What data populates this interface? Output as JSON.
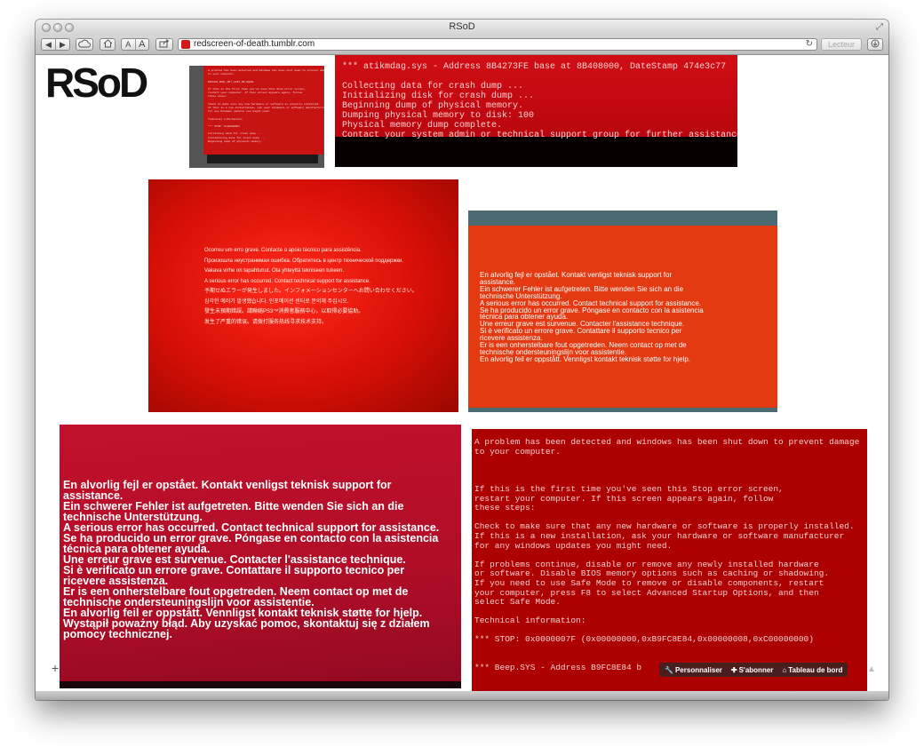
{
  "window": {
    "title": "RSoD"
  },
  "toolbar": {
    "font_small": "A",
    "font_large": "A",
    "url": "redscreen-of-death.tumblr.com",
    "reader_label": "Lecteur"
  },
  "blog": {
    "logo": "RSoD"
  },
  "photos": {
    "p1": {
      "lines": [
        "A problem has been detected and Windows has been shut down to prevent damage",
        "to your computer.",
        "",
        "DRIVER_IRQL_NOT_LESS_OR_EQUAL",
        "",
        "If this is the first time you've seen this Stop error screen,",
        "restart your computer. If this screen appears again, follow",
        "these steps:",
        "",
        "Check to make sure any new hardware or software is properly installed.",
        "If this is a new installation, ask your hardware or software manufacturer",
        "for any Windows updates you might need.",
        "",
        "Technical information:",
        "",
        "*** STOP: 0x000000D1",
        "",
        "Collecting data for crash dump ...",
        "Initializing disk for crash dump ...",
        "Beginning dump of physical memory."
      ]
    },
    "p2": {
      "lines": [
        "***  atikmdag.sys - Address 8B4273FE base at 8B408000, DateStamp 474e3c77",
        "",
        "Collecting data for crash dump ...",
        "Initializing disk for crash dump ...",
        "Beginning dump of physical memory.",
        "Dumping physical memory to disk:  100",
        "Physical memory dump complete.",
        "Contact your system admin or technical support group for further assistance."
      ]
    },
    "p3": {
      "lines": [
        "Ocorreu um erro grave. Contacte o apoio técnico para assistência.",
        "Произошла неустранимая ошибка. Обратитесь в центр технической поддержки.",
        "Vakava virhe on tapahtunut. Ota yhteyttä tekniseen tukeen.",
        "A serious error has occurred. Contact technical support for assistance.",
        "予期せぬエラーが発生しました。インフォメーションセンターへお問い合わせください。",
        "심각한 에러가 발생했습니다. 인포메이션 센터로 문의해 주십시오.",
        "發生未預期錯誤。請聯絡PS3™消費者服務中心，以取得必要協助。",
        "发生了严重的错误。请拨打服务热线寻求技术支持。"
      ]
    },
    "p4": {
      "lines": [
        "En alvorlig fejl er opstået. Kontakt venligst teknisk support for",
        "assistance.",
        "Ein schwerer Fehler ist aufgetreten. Bitte wenden Sie sich an die",
        "technische Unterstützung.",
        "A serious error has occurred. Contact technical support for assistance.",
        "Se ha producido un error grave. Póngase en contacto con la asistencia",
        "técnica para obtener ayuda.",
        "Une erreur grave est survenue. Contacter l'assistance technique.",
        "Si è verificato un errore grave. Contattare il supporto tecnico per",
        "ricevere assistenza.",
        "Er is een onherstelbare fout opgetreden. Neem contact op met de",
        "technische ondersteuningslijn voor assistentie.",
        "En alvorlig feil er oppstått. Vennligst kontakt teknisk støtte for hjelp."
      ]
    },
    "p5": {
      "lines": [
        "En alvorlig fejl er opstået. Kontakt venligst teknisk support for",
        "assistance.",
        "Ein schwerer Fehler ist aufgetreten. Bitte wenden Sie sich an die",
        "technische Unterstützung.",
        "A serious error has occurred. Contact technical support for assistance.",
        "Se ha producido un error grave. Póngase en contacto con la asistencia",
        "técnica para obtener ayuda.",
        "Une erreur grave est survenue. Contacter l'assistance technique.",
        "Si è verificato un errore grave. Contattare il supporto tecnico per",
        "ricevere assistenza.",
        "Er is een onherstelbare fout opgetreden. Neem contact op met de",
        "technische ondersteuningslijn voor assistentie.",
        "En alvorlig feil er oppstått. Vennligst kontakt teknisk støtte for hjelp.",
        "Wystąpił poważny błąd. Aby uzyskać pomoc, skontaktuj się z działem",
        "pomocy technicznej."
      ]
    },
    "p6": {
      "lines": [
        "A problem has been detected and windows has been shut down to prevent damage",
        "to your computer.",
        "",
        "",
        "",
        "If this is the first time you've seen this Stop error screen,",
        "restart your computer. If this screen appears again, follow",
        "these steps:",
        "",
        "Check to make sure that any new hardware or software is properly installed.",
        "If this is a new installation, ask your hardware or software manufacturer",
        "for any windows updates you might need.",
        "",
        "If problems continue, disable or remove any newly installed hardware",
        "or software. Disable BIOS memory options such as caching or shadowing.",
        "If you need to use Safe Mode to remove or disable components, restart",
        "your computer, press F8 to select Advanced Startup Options, and then",
        "select Safe Mode.",
        "",
        "Technical information:",
        "",
        "*** STOP: 0x0000007F (0x00000000,0xB9FC8E84,0x00000008,0xC00000000)",
        "",
        "",
        "***       Beep.SYS - Address B9FC8E84 b"
      ]
    }
  },
  "tumblr_controls": {
    "customize": "Personnaliser",
    "follow": "S'abonner",
    "dashboard": "Tableau de bord"
  },
  "controls": {
    "add": "+"
  }
}
